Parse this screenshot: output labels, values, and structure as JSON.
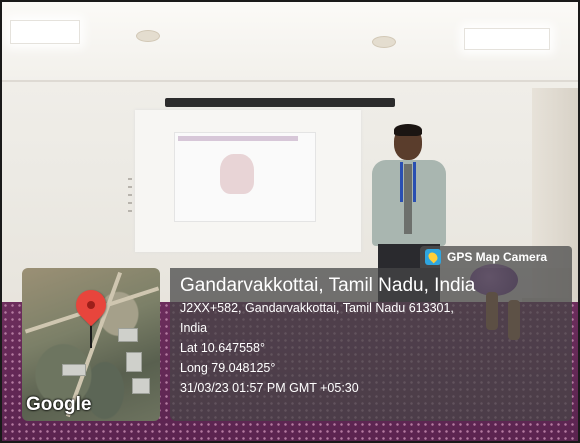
{
  "overlay": {
    "tag_label": "GPS Map Camera",
    "tag_icon": "gps-map-camera-icon"
  },
  "map": {
    "brand": "Google",
    "pin_icon": "location-pin-icon"
  },
  "location": {
    "title": "Gandarvakkottai, Tamil Nadu, India",
    "address_line1": "J2XX+582, Gandarvakkottai, Tamil Nadu 613301,",
    "address_line2": "India",
    "latitude": "Lat 10.647558°",
    "longitude": "Long 79.048125°",
    "timestamp": "31/03/23 01:57 PM GMT +05:30"
  },
  "colors": {
    "table_cloth": "#5b2450",
    "overlay_bg": "#464646",
    "pin": "#e8453c",
    "camera_icon": "#2fa6e0"
  }
}
